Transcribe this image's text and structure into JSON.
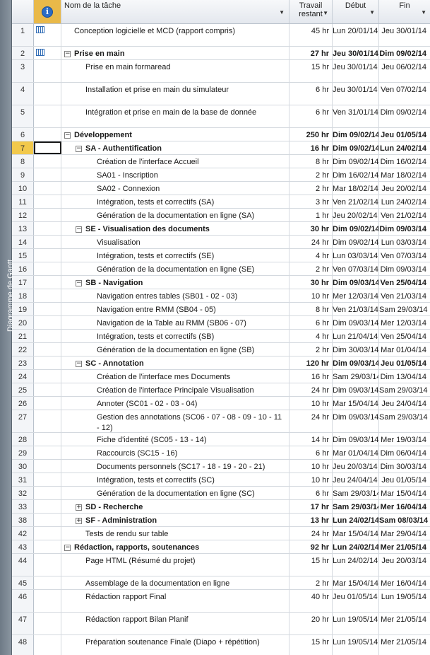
{
  "sidebar": {
    "label": "Diagramme de Gantt"
  },
  "header": {
    "info_symbol": "i",
    "name": "Nom de la tâche",
    "work": "Travail restant",
    "start": "Début",
    "end": "Fin"
  },
  "rows": [
    {
      "id": "1",
      "name": "Conception logicielle et MCD (rapport compris)",
      "work": "45 hr",
      "start": "Lun 20/01/14",
      "end": "Jeu 30/01/14",
      "level": 0,
      "summary": false,
      "icon": "calendar-icon",
      "h": 32
    },
    {
      "id": "2",
      "name": "Prise en main",
      "work": "27 hr",
      "start": "Jeu 30/01/14",
      "end": "Dim 09/02/14",
      "level": 0,
      "summary": true,
      "toggle": "−",
      "icon": "calendar-icon",
      "h": 19
    },
    {
      "id": "3",
      "name": "Prise en main formaread",
      "work": "15 hr",
      "start": "Jeu 30/01/14",
      "end": "Jeu 06/02/14",
      "level": 1,
      "summary": false,
      "h": 32
    },
    {
      "id": "4",
      "name": "Installation et prise en main du simulateur",
      "work": "6 hr",
      "start": "Jeu 30/01/14",
      "end": "Ven 07/02/14",
      "level": 1,
      "summary": false,
      "h": 32
    },
    {
      "id": "5",
      "name": "Intégration et prise en main de la base de donnée",
      "work": "6 hr",
      "start": "Ven 31/01/14",
      "end": "Dim 09/02/14",
      "level": 1,
      "summary": false,
      "h": 32
    },
    {
      "id": "6",
      "name": "Développement",
      "work": "250 hr",
      "start": "Dim 09/02/14",
      "end": "Jeu 01/05/14",
      "level": 0,
      "summary": true,
      "toggle": "−",
      "h": 19
    },
    {
      "id": "7",
      "name": "SA - Authentification",
      "work": "16 hr",
      "start": "Dim 09/02/14",
      "end": "Lun 24/02/14",
      "level": 1,
      "summary": true,
      "toggle": "−",
      "selected": true,
      "h": 19
    },
    {
      "id": "8",
      "name": "Création de l'interface Accueil",
      "work": "8 hr",
      "start": "Dim 09/02/14",
      "end": "Dim 16/02/14",
      "level": 2,
      "summary": false,
      "h": 19
    },
    {
      "id": "9",
      "name": "SA01 - Inscription",
      "work": "2 hr",
      "start": "Dim 16/02/14",
      "end": "Mar 18/02/14",
      "level": 2,
      "summary": false,
      "h": 19
    },
    {
      "id": "10",
      "name": "SA02 - Connexion",
      "work": "2 hr",
      "start": "Mar 18/02/14",
      "end": "Jeu 20/02/14",
      "level": 2,
      "summary": false,
      "h": 19
    },
    {
      "id": "11",
      "name": "Intégration, tests et correctifs (SA)",
      "work": "3 hr",
      "start": "Ven 21/02/14",
      "end": "Lun 24/02/14",
      "level": 2,
      "summary": false,
      "h": 19
    },
    {
      "id": "12",
      "name": "Génération de la documentation en ligne (SA)",
      "work": "1 hr",
      "start": "Jeu 20/02/14",
      "end": "Ven 21/02/14",
      "level": 2,
      "summary": false,
      "h": 19
    },
    {
      "id": "13",
      "name": "SE - Visualisation des documents",
      "work": "30 hr",
      "start": "Dim 09/02/14",
      "end": "Dim 09/03/14",
      "level": 1,
      "summary": true,
      "toggle": "−",
      "h": 19
    },
    {
      "id": "14",
      "name": "Visualisation",
      "work": "24 hr",
      "start": "Dim 09/02/14",
      "end": "Lun 03/03/14",
      "level": 2,
      "summary": false,
      "h": 19
    },
    {
      "id": "15",
      "name": "Intégration, tests et correctifs (SE)",
      "work": "4 hr",
      "start": "Lun 03/03/14",
      "end": "Ven 07/03/14",
      "level": 2,
      "summary": false,
      "h": 19
    },
    {
      "id": "16",
      "name": "Génération de la documentation en ligne (SE)",
      "work": "2 hr",
      "start": "Ven 07/03/14",
      "end": "Dim 09/03/14",
      "level": 2,
      "summary": false,
      "h": 19
    },
    {
      "id": "17",
      "name": "SB - Navigation",
      "work": "30 hr",
      "start": "Dim 09/03/14",
      "end": "Ven 25/04/14",
      "level": 1,
      "summary": true,
      "toggle": "−",
      "h": 19
    },
    {
      "id": "18",
      "name": "Navigation entres tables (SB01 - 02 - 03)",
      "work": "10 hr",
      "start": "Mer 12/03/14",
      "end": "Ven 21/03/14",
      "level": 2,
      "summary": false,
      "h": 19
    },
    {
      "id": "19",
      "name": "Navigation entre RMM (SB04 - 05)",
      "work": "8 hr",
      "start": "Ven 21/03/14",
      "end": "Sam 29/03/14",
      "level": 2,
      "summary": false,
      "h": 19
    },
    {
      "id": "20",
      "name": "Navigation de la Table au RMM (SB06 - 07)",
      "work": "6 hr",
      "start": "Dim 09/03/14",
      "end": "Mer 12/03/14",
      "level": 2,
      "summary": false,
      "h": 19
    },
    {
      "id": "21",
      "name": "Intégration, tests et correctifs (SB)",
      "work": "4 hr",
      "start": "Lun 21/04/14",
      "end": "Ven 25/04/14",
      "level": 2,
      "summary": false,
      "h": 19
    },
    {
      "id": "22",
      "name": "Génération de la documentation en ligne (SB)",
      "work": "2 hr",
      "start": "Dim 30/03/14",
      "end": "Mar 01/04/14",
      "level": 2,
      "summary": false,
      "h": 19
    },
    {
      "id": "23",
      "name": "SC - Annotation",
      "work": "120 hr",
      "start": "Dim 09/03/14",
      "end": "Jeu 01/05/14",
      "level": 1,
      "summary": true,
      "toggle": "−",
      "h": 19
    },
    {
      "id": "24",
      "name": "Création de l'interface mes Documents",
      "work": "16 hr",
      "start": "Sam 29/03/14",
      "end": "Dim 13/04/14",
      "level": 2,
      "summary": false,
      "h": 19
    },
    {
      "id": "25",
      "name": "Création de l'interface Principale Visualisation",
      "work": "24 hr",
      "start": "Dim 09/03/14",
      "end": "Sam 29/03/14",
      "level": 2,
      "summary": false,
      "h": 19
    },
    {
      "id": "26",
      "name": "Annoter (SC01 - 02 - 03 - 04)",
      "work": "10 hr",
      "start": "Mar 15/04/14",
      "end": "Jeu 24/04/14",
      "level": 2,
      "summary": false,
      "h": 19
    },
    {
      "id": "27",
      "name": "Gestion des annotations (SC06 - 07 - 08 - 09 - 10 - 11 - 12)",
      "work": "24 hr",
      "start": "Dim 09/03/14",
      "end": "Sam 29/03/14",
      "level": 2,
      "summary": false,
      "wrap": true,
      "h": 32
    },
    {
      "id": "28",
      "name": "Fiche d'identité (SC05 - 13 - 14)",
      "work": "14 hr",
      "start": "Dim 09/03/14",
      "end": "Mer 19/03/14",
      "level": 2,
      "summary": false,
      "h": 19
    },
    {
      "id": "29",
      "name": "Raccourcis (SC15 - 16)",
      "work": "6 hr",
      "start": "Mar 01/04/14",
      "end": "Dim 06/04/14",
      "level": 2,
      "summary": false,
      "h": 19
    },
    {
      "id": "30",
      "name": "Documents personnels (SC17 - 18 - 19 - 20 - 21)",
      "work": "10 hr",
      "start": "Jeu 20/03/14",
      "end": "Dim 30/03/14",
      "level": 2,
      "summary": false,
      "h": 19
    },
    {
      "id": "31",
      "name": "Intégration, tests et correctifs (SC)",
      "work": "10 hr",
      "start": "Jeu 24/04/14",
      "end": "Jeu 01/05/14",
      "level": 2,
      "summary": false,
      "h": 19
    },
    {
      "id": "32",
      "name": "Génération de la documentation en ligne (SC)",
      "work": "6 hr",
      "start": "Sam 29/03/14",
      "end": "Mar 15/04/14",
      "level": 2,
      "summary": false,
      "h": 19
    },
    {
      "id": "33",
      "name": "SD - Recherche",
      "work": "17 hr",
      "start": "Sam 29/03/14",
      "end": "Mer 16/04/14",
      "level": 1,
      "summary": true,
      "toggle": "+",
      "h": 19
    },
    {
      "id": "38",
      "name": "SF - Administration",
      "work": "13 hr",
      "start": "Lun 24/02/14",
      "end": "Sam 08/03/14",
      "level": 1,
      "summary": true,
      "toggle": "+",
      "h": 19
    },
    {
      "id": "42",
      "name": "Tests de rendu sur table",
      "work": "24 hr",
      "start": "Mar 15/04/14",
      "end": "Mar 29/04/14",
      "level": 1,
      "summary": false,
      "h": 19
    },
    {
      "id": "43",
      "name": "Rédaction, rapports, soutenances",
      "work": "92 hr",
      "start": "Lun 24/02/14",
      "end": "Mer 21/05/14",
      "level": 0,
      "summary": true,
      "toggle": "−",
      "h": 19
    },
    {
      "id": "44",
      "name": "Page HTML (Résumé du projet)",
      "work": "15 hr",
      "start": "Lun 24/02/14",
      "end": "Jeu 20/03/14",
      "level": 1,
      "summary": false,
      "h": 32
    },
    {
      "id": "45",
      "name": "Assemblage de la documentation en ligne",
      "work": "2 hr",
      "start": "Mar 15/04/14",
      "end": "Mer 16/04/14",
      "level": 1,
      "summary": false,
      "h": 19
    },
    {
      "id": "46",
      "name": "Rédaction rapport Final",
      "work": "40 hr",
      "start": "Jeu 01/05/14",
      "end": "Lun 19/05/14",
      "level": 1,
      "summary": false,
      "h": 32
    },
    {
      "id": "47",
      "name": "Rédaction rapport Bilan Planif",
      "work": "20 hr",
      "start": "Lun 19/05/14",
      "end": "Mer 21/05/14",
      "level": 1,
      "summary": false,
      "h": 32
    },
    {
      "id": "48",
      "name": "Préparation soutenance Finale (Diapo + répétition)",
      "work": "15 hr",
      "start": "Lun 19/05/14",
      "end": "Mer 21/05/14",
      "level": 1,
      "summary": false,
      "h": 32
    }
  ]
}
